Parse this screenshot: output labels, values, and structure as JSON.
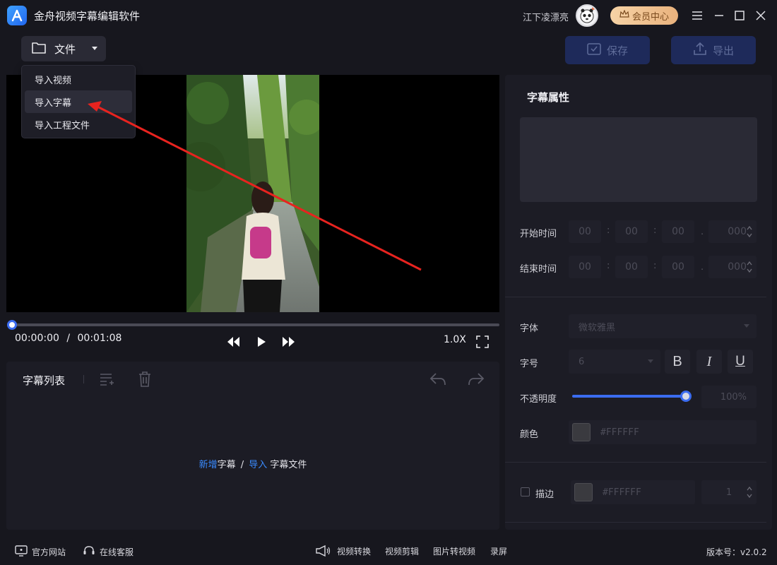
{
  "app": {
    "title": "金舟视频字幕编辑软件"
  },
  "user": {
    "name": "江下凌漂亮",
    "vip_label": "会员中心"
  },
  "toolbar": {
    "file_label": "文件",
    "save_label": "保存",
    "export_label": "导出"
  },
  "file_menu": {
    "items": [
      "导入视频",
      "导入字幕",
      "导入工程文件"
    ],
    "highlighted": "导入字幕"
  },
  "player": {
    "current_time": "00:00:00",
    "separator": "/",
    "duration": "00:01:08",
    "speed": "1.0X"
  },
  "subtitle_list": {
    "title": "字幕列表",
    "empty_hint": {
      "add_link": "新增",
      "add_text": "字幕",
      "divider": "/",
      "import_link": "导入",
      "import_text": "字幕文件"
    }
  },
  "properties": {
    "title": "字幕属性",
    "start_label": "开始时间",
    "end_label": "结束时间",
    "start_time": {
      "h": "00",
      "m": "00",
      "s": "00",
      "ms": "000"
    },
    "end_time": {
      "h": "00",
      "m": "00",
      "s": "00",
      "ms": "000"
    },
    "colon": ":",
    "dot": ".",
    "font_label": "字体",
    "font_value": "微软雅黑",
    "size_label": "字号",
    "size_value": "6",
    "bold": "B",
    "italic": "I",
    "underline": "U",
    "opacity_label": "不透明度",
    "opacity_value": "100%",
    "opacity": 1.0,
    "color_label": "颜色",
    "color_value": "#FFFFFF",
    "stroke_label": "描边",
    "stroke_color_value": "#FFFFFF",
    "stroke_width": "1"
  },
  "footer": {
    "website": "官方网站",
    "support": "在线客服",
    "tools": [
      "视频转换",
      "视频剪辑",
      "图片转视频",
      "录屏"
    ],
    "version": "版本号：v2.0.2"
  },
  "colors": {
    "accent": "#3b6cf0",
    "link": "#3a8bff",
    "arrow": "#e8231f"
  }
}
